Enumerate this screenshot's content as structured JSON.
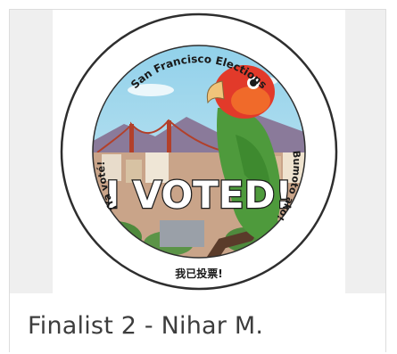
{
  "card": {
    "caption": "Finalist 2 - Nihar M.",
    "image_alt": "I Voted sticker with a parrot over San Francisco"
  },
  "sticker": {
    "top_text": "San Francisco Elections",
    "main_text": "I VOTED!",
    "left_text": "¡Ya voté!",
    "right_text": "Bumoto ako!",
    "bottom_text": "我已投票!",
    "colors": {
      "sky": "#7ec3e0",
      "parrot_body": "#4e9a3c",
      "parrot_head": "#e23a2a",
      "bridge": "#b2402a",
      "ring": "#2e2e2e"
    }
  }
}
